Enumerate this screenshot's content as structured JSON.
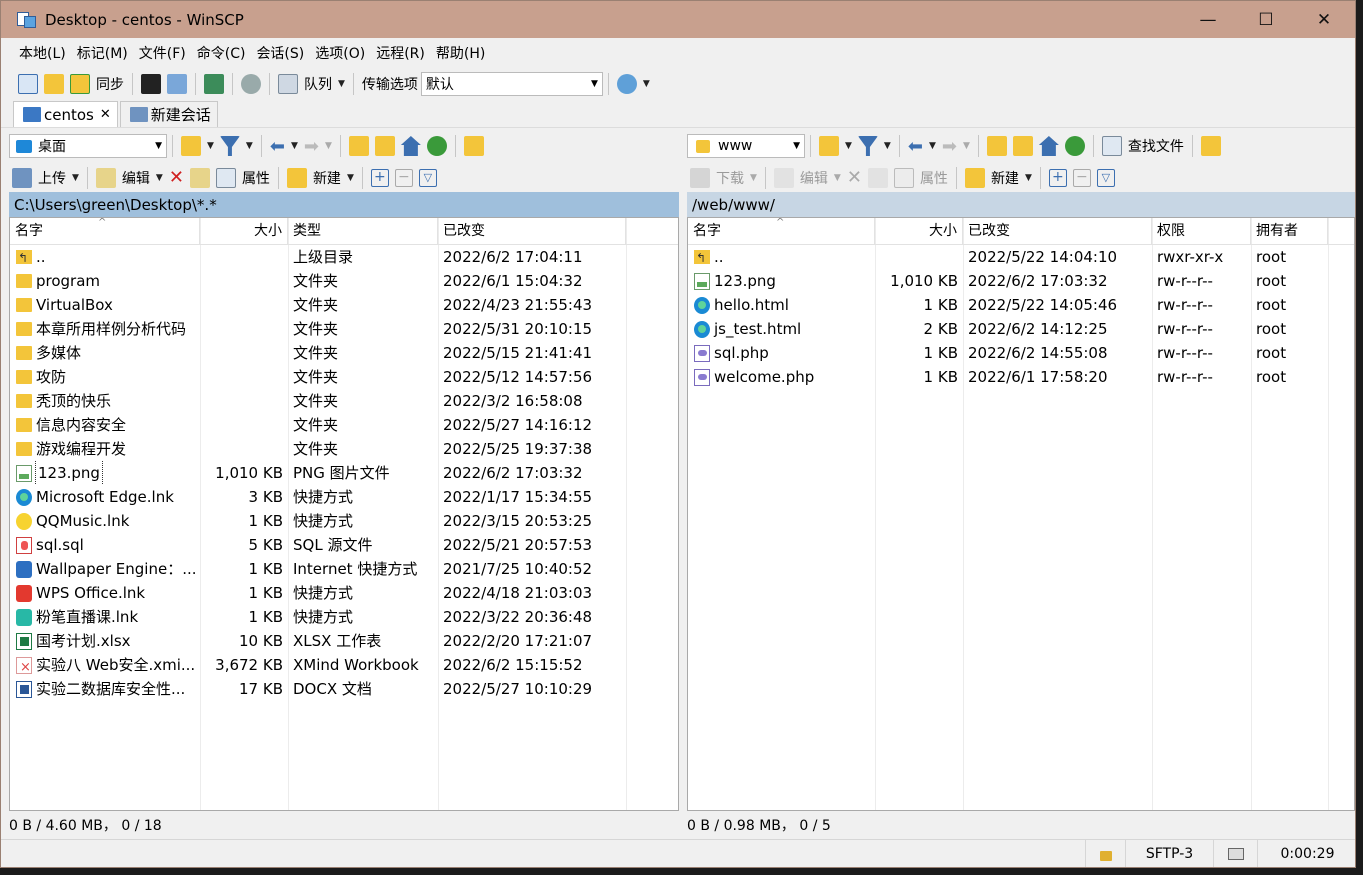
{
  "window": {
    "title": "Desktop - centos - WinSCP"
  },
  "menu": [
    "本地(L)",
    "标记(M)",
    "文件(F)",
    "命令(C)",
    "会话(S)",
    "选项(O)",
    "远程(R)",
    "帮助(H)"
  ],
  "toolbar": {
    "sync_label": "同步",
    "queue_label": "队列",
    "transfer_options_label": "传输选项",
    "transfer_preset": "默认"
  },
  "tabs": {
    "session": "centos",
    "new_session": "新建会话"
  },
  "left": {
    "location": "桌面",
    "upload_label": "上传",
    "edit_label": "编辑",
    "properties_label": "属性",
    "new_label": "新建",
    "path": "C:\\Users\\green\\Desktop\\*.*",
    "columns": [
      "名字",
      "大小",
      "类型",
      "已改变"
    ],
    "files": [
      {
        "name": "..",
        "size": "",
        "type": "上级目录",
        "changed": "2022/6/2  17:04:11",
        "icon": "up"
      },
      {
        "name": "program",
        "size": "",
        "type": "文件夹",
        "changed": "2022/6/1  15:04:32",
        "icon": "folder"
      },
      {
        "name": "VirtualBox",
        "size": "",
        "type": "文件夹",
        "changed": "2022/4/23  21:55:43",
        "icon": "folder"
      },
      {
        "name": "本章所用样例分析代码",
        "size": "",
        "type": "文件夹",
        "changed": "2022/5/31  20:10:15",
        "icon": "folder"
      },
      {
        "name": "多媒体",
        "size": "",
        "type": "文件夹",
        "changed": "2022/5/15  21:41:41",
        "icon": "folder"
      },
      {
        "name": "攻防",
        "size": "",
        "type": "文件夹",
        "changed": "2022/5/12  14:57:56",
        "icon": "folder"
      },
      {
        "name": "秃顶的快乐",
        "size": "",
        "type": "文件夹",
        "changed": "2022/3/2  16:58:08",
        "icon": "folder"
      },
      {
        "name": "信息内容安全",
        "size": "",
        "type": "文件夹",
        "changed": "2022/5/27  14:16:12",
        "icon": "folder"
      },
      {
        "name": "游戏编程开发",
        "size": "",
        "type": "文件夹",
        "changed": "2022/5/25  19:37:38",
        "icon": "folder"
      },
      {
        "name": "123.png",
        "size": "1,010 KB",
        "type": "PNG 图片文件",
        "changed": "2022/6/2  17:03:32",
        "icon": "png",
        "focused": true
      },
      {
        "name": "Microsoft Edge.lnk",
        "size": "3 KB",
        "type": "快捷方式",
        "changed": "2022/1/17  15:34:55",
        "icon": "edge"
      },
      {
        "name": "QQMusic.lnk",
        "size": "1 KB",
        "type": "快捷方式",
        "changed": "2022/3/15  20:53:25",
        "icon": "qq"
      },
      {
        "name": "sql.sql",
        "size": "5 KB",
        "type": "SQL 源文件",
        "changed": "2022/5/21  20:57:53",
        "icon": "sql"
      },
      {
        "name": "Wallpaper Engine：...",
        "size": "1 KB",
        "type": "Internet 快捷方式",
        "changed": "2021/7/25  10:40:52",
        "icon": "wall"
      },
      {
        "name": "WPS Office.lnk",
        "size": "1 KB",
        "type": "快捷方式",
        "changed": "2022/4/18  21:03:03",
        "icon": "wps"
      },
      {
        "name": "粉笔直播课.lnk",
        "size": "1 KB",
        "type": "快捷方式",
        "changed": "2022/3/22  20:36:48",
        "icon": "fenbi"
      },
      {
        "name": "国考计划.xlsx",
        "size": "10 KB",
        "type": "XLSX 工作表",
        "changed": "2022/2/20  17:21:07",
        "icon": "xlsx"
      },
      {
        "name": "实验八 Web安全.xmi...",
        "size": "3,672 KB",
        "type": "XMind Workbook",
        "changed": "2022/6/2  15:15:52",
        "icon": "xmind"
      },
      {
        "name": "实验二数据库安全性...",
        "size": "17 KB",
        "type": "DOCX 文档",
        "changed": "2022/5/27  10:10:29",
        "icon": "docx"
      }
    ],
    "status": "0 B / 4.60 MB， 0 / 18"
  },
  "right": {
    "location": "www",
    "find_label": "查找文件",
    "download_label": "下载",
    "edit_label": "编辑",
    "properties_label": "属性",
    "new_label": "新建",
    "path": "/web/www/",
    "columns": [
      "名字",
      "大小",
      "已改变",
      "权限",
      "拥有者"
    ],
    "files": [
      {
        "name": "..",
        "size": "",
        "changed": "2022/5/22 14:04:10",
        "rights": "rwxr-xr-x",
        "owner": "root",
        "icon": "up"
      },
      {
        "name": "123.png",
        "size": "1,010 KB",
        "changed": "2022/6/2 17:03:32",
        "rights": "rw-r--r--",
        "owner": "root",
        "icon": "png"
      },
      {
        "name": "hello.html",
        "size": "1 KB",
        "changed": "2022/5/22 14:05:46",
        "rights": "rw-r--r--",
        "owner": "root",
        "icon": "html"
      },
      {
        "name": "js_test.html",
        "size": "2 KB",
        "changed": "2022/6/2 14:12:25",
        "rights": "rw-r--r--",
        "owner": "root",
        "icon": "html"
      },
      {
        "name": "sql.php",
        "size": "1 KB",
        "changed": "2022/6/2 14:55:08",
        "rights": "rw-r--r--",
        "owner": "root",
        "icon": "php"
      },
      {
        "name": "welcome.php",
        "size": "1 KB",
        "changed": "2022/6/1 17:58:20",
        "rights": "rw-r--r--",
        "owner": "root",
        "icon": "php"
      }
    ],
    "status": "0 B / 0.98 MB， 0 / 5"
  },
  "statusbar": {
    "protocol": "SFTP-3",
    "elapsed": "0:00:29"
  }
}
